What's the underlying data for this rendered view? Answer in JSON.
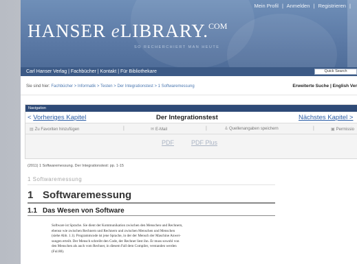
{
  "topnav": {
    "items": [
      "Mein Profil",
      "Anmelden",
      "Registrieren",
      "|"
    ]
  },
  "logo": {
    "hanser": "HANSER",
    "e": "e",
    "library": "LIBRARY.",
    "com": "COM",
    "tagline": "SO RECHERCHIERT MAN HEUTE"
  },
  "linksbar": {
    "text": "Carl Hanser Verlag  |  Fachbücher  |  Kontakt  | Für Bibliothekare"
  },
  "search": {
    "placeholder": "Quick Search"
  },
  "breadcrumb": {
    "prefix": "Sie sind hier:",
    "path": "Fachbücher > Informatik > Testen > Der Integrationstest > 1 Softwaremessung",
    "right": "Erweiterte Suche  |  English Ver"
  },
  "navigation": {
    "header": "Navigation",
    "prev_arrow": "<",
    "prev_label": "Vorheriges Kapitel",
    "chapter_title": "Der Integrationstest",
    "next_label": "Nächstes Kapitel >",
    "tools": {
      "favorites": "Zu Favoriten hinzufügen",
      "email": "E-Mail",
      "citation": "Quellenangaben speichern",
      "permissions": "Permissio"
    },
    "formats": {
      "pdf": "PDF",
      "pdf_plus": "PDF Plus"
    }
  },
  "content": {
    "citation": "(2011) 1 Softwaremessung. Der Integrationstest: pp. 1-15",
    "section_label": "1 Softwaremessung",
    "h1_num": "1",
    "h1_title": "Softwaremessung",
    "h2_num": "1.1",
    "h2_title": "Das Wesen von Software",
    "body_lines": [
      "Software ist Sprache. Sie dient der Kommunikation zwischen den Menschen und Rechnern,",
      "ebenso wie zwischen Rechnern und Rechnern und zwischen Menschen und Menschen",
      "(siehe Abb. 1.1). Programmcode ist jene Sprache, in der der Mensch der Maschine Anwei-",
      "sungen erteilt. Der Mensch schreibt den Code, der Rechner liest ihn. Er muss sowohl von",
      "den Menschen als auch vom Rechner, in diesem Fall dem Compiler, verstanden werden",
      "(Ful.88)."
    ]
  },
  "colors": {
    "header_blue": "#5c7aa6",
    "links_bar": "#3c5a86",
    "nav_header": "#2e4a77",
    "link_blue": "#2a5da6"
  }
}
